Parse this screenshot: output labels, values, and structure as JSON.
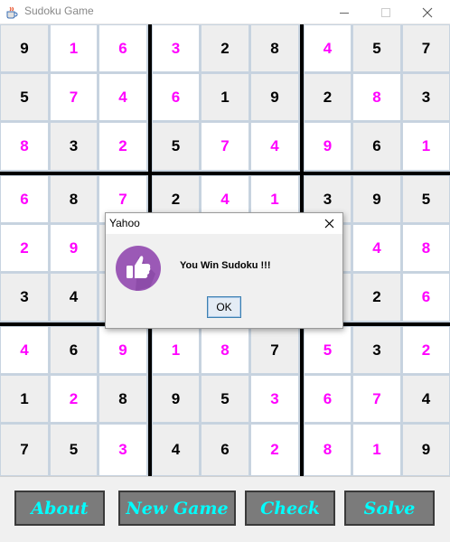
{
  "window": {
    "title": "Sudoku Game",
    "icons": {
      "app": "java-cup-icon",
      "minimize": "minimize-icon",
      "maximize": "maximize-icon",
      "close": "close-icon"
    }
  },
  "board": {
    "rows": [
      [
        "9",
        "1",
        "6",
        "3",
        "2",
        "8",
        "4",
        "5",
        "7"
      ],
      [
        "5",
        "7",
        "4",
        "6",
        "1",
        "9",
        "2",
        "8",
        "3"
      ],
      [
        "8",
        "3",
        "2",
        "5",
        "7",
        "4",
        "9",
        "6",
        "1"
      ],
      [
        "6",
        "8",
        "7",
        "2",
        "4",
        "1",
        "3",
        "9",
        "5"
      ],
      [
        "2",
        "9",
        "",
        "",
        "",
        "",
        "",
        "4",
        "8"
      ],
      [
        "3",
        "4",
        "",
        "",
        "",
        "",
        "",
        "2",
        "6"
      ],
      [
        "4",
        "6",
        "9",
        "1",
        "8",
        "7",
        "5",
        "3",
        "2"
      ],
      [
        "1",
        "2",
        "8",
        "9",
        "5",
        "3",
        "6",
        "7",
        "4"
      ],
      [
        "7",
        "5",
        "3",
        "4",
        "6",
        "2",
        "8",
        "1",
        "9"
      ]
    ],
    "entered": [
      [
        0,
        1,
        1,
        1,
        0,
        0,
        1,
        0,
        0
      ],
      [
        0,
        1,
        1,
        1,
        0,
        0,
        0,
        1,
        0
      ],
      [
        1,
        0,
        1,
        0,
        1,
        1,
        1,
        0,
        1
      ],
      [
        1,
        0,
        1,
        0,
        1,
        1,
        0,
        0,
        0
      ],
      [
        1,
        1,
        0,
        0,
        0,
        0,
        0,
        1,
        1
      ],
      [
        0,
        0,
        0,
        0,
        0,
        0,
        0,
        0,
        1
      ],
      [
        1,
        0,
        1,
        1,
        1,
        0,
        1,
        0,
        1
      ],
      [
        0,
        1,
        0,
        0,
        0,
        1,
        1,
        1,
        0
      ],
      [
        0,
        0,
        1,
        0,
        0,
        1,
        1,
        1,
        0
      ]
    ],
    "colors": {
      "given_text": "#000000",
      "entered_text": "#ff00ff",
      "given_bg": "#eeeeee",
      "entered_bg": "#ffffff"
    }
  },
  "buttons": {
    "about": "About",
    "new_game": "New Game",
    "check": "Check",
    "solve": "Solve",
    "colors": {
      "text": "#00ffff",
      "background": "#7b7b7b"
    }
  },
  "dialog": {
    "title": "Yahoo",
    "message": "You Win Sudoku !!!",
    "ok_label": "OK",
    "icon": "thumbs-up-icon",
    "icon_color": "#9b59b6"
  }
}
